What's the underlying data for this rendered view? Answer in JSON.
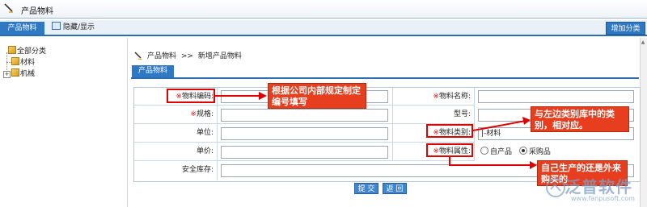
{
  "window": {
    "title": "产品物料"
  },
  "tabs": {
    "active_tab": "产品物料",
    "toggle_label": "隐藏/显示",
    "add_category": "增加分类"
  },
  "tree": {
    "root": "全部分类",
    "children": [
      "材料",
      "机械"
    ]
  },
  "breadcrumb": {
    "root": "产品物料",
    "separator": ">>",
    "current": "新增产品物料"
  },
  "section_tab": "产品物料",
  "form": {
    "required_mark": "※",
    "code_label": "物料编码:",
    "name_label": "物料名称:",
    "spec_label": "规格:",
    "model_label": "型号:",
    "unit_label": "单位:",
    "category_label": "物料类别:",
    "category_value": "|-材料",
    "price_label": "单价:",
    "attr_label": "物料属性:",
    "attr_options": [
      "自产品",
      "采购品"
    ],
    "attr_selected": "采购品",
    "safety_stock_label": "安全库存:"
  },
  "buttons": {
    "submit": "提 交",
    "back": "返 回"
  },
  "annotations": {
    "code_note": "根据公司内部规定制定编号填写",
    "category_note": "与左边类别库中的类别，相对应。",
    "attr_note": "自己生产的还是外来购买的"
  },
  "watermark": {
    "text": "泛普软件",
    "url": "www.fanpusoft.com"
  },
  "colors": {
    "accent": "#2f78c4",
    "annotation": "#e63e1e",
    "required": "#e01010"
  }
}
